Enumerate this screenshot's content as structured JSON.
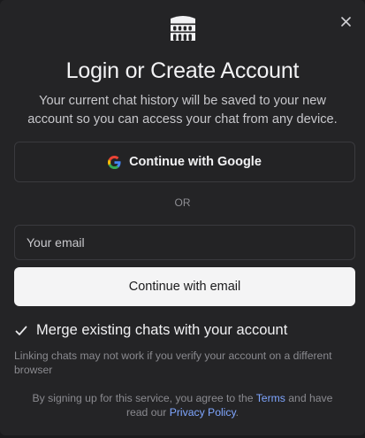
{
  "dialog": {
    "title": "Login or Create Account",
    "subtitle": "Your current chat history will be saved to your new account so you can access your chat from any device.",
    "close_icon": "close-icon",
    "logo_icon": "colosseum-logo-icon"
  },
  "google": {
    "label": "Continue with Google",
    "icon": "google-icon"
  },
  "divider_text": "OR",
  "email": {
    "placeholder": "Your email",
    "value": ""
  },
  "email_button": {
    "label": "Continue with email"
  },
  "merge": {
    "label": "Merge existing chats with your account",
    "checked": true
  },
  "note": "Linking chats may not work if you verify your account on a different browser",
  "terms": {
    "prefix": "By signing up for this service, you agree to the ",
    "terms_link": "Terms",
    "middle": " and have read our ",
    "privacy_link": "Privacy Policy",
    "suffix": "."
  },
  "colors": {
    "background": "#242426",
    "link": "#7fa6ff",
    "primary_button": "#f4f4f5"
  }
}
